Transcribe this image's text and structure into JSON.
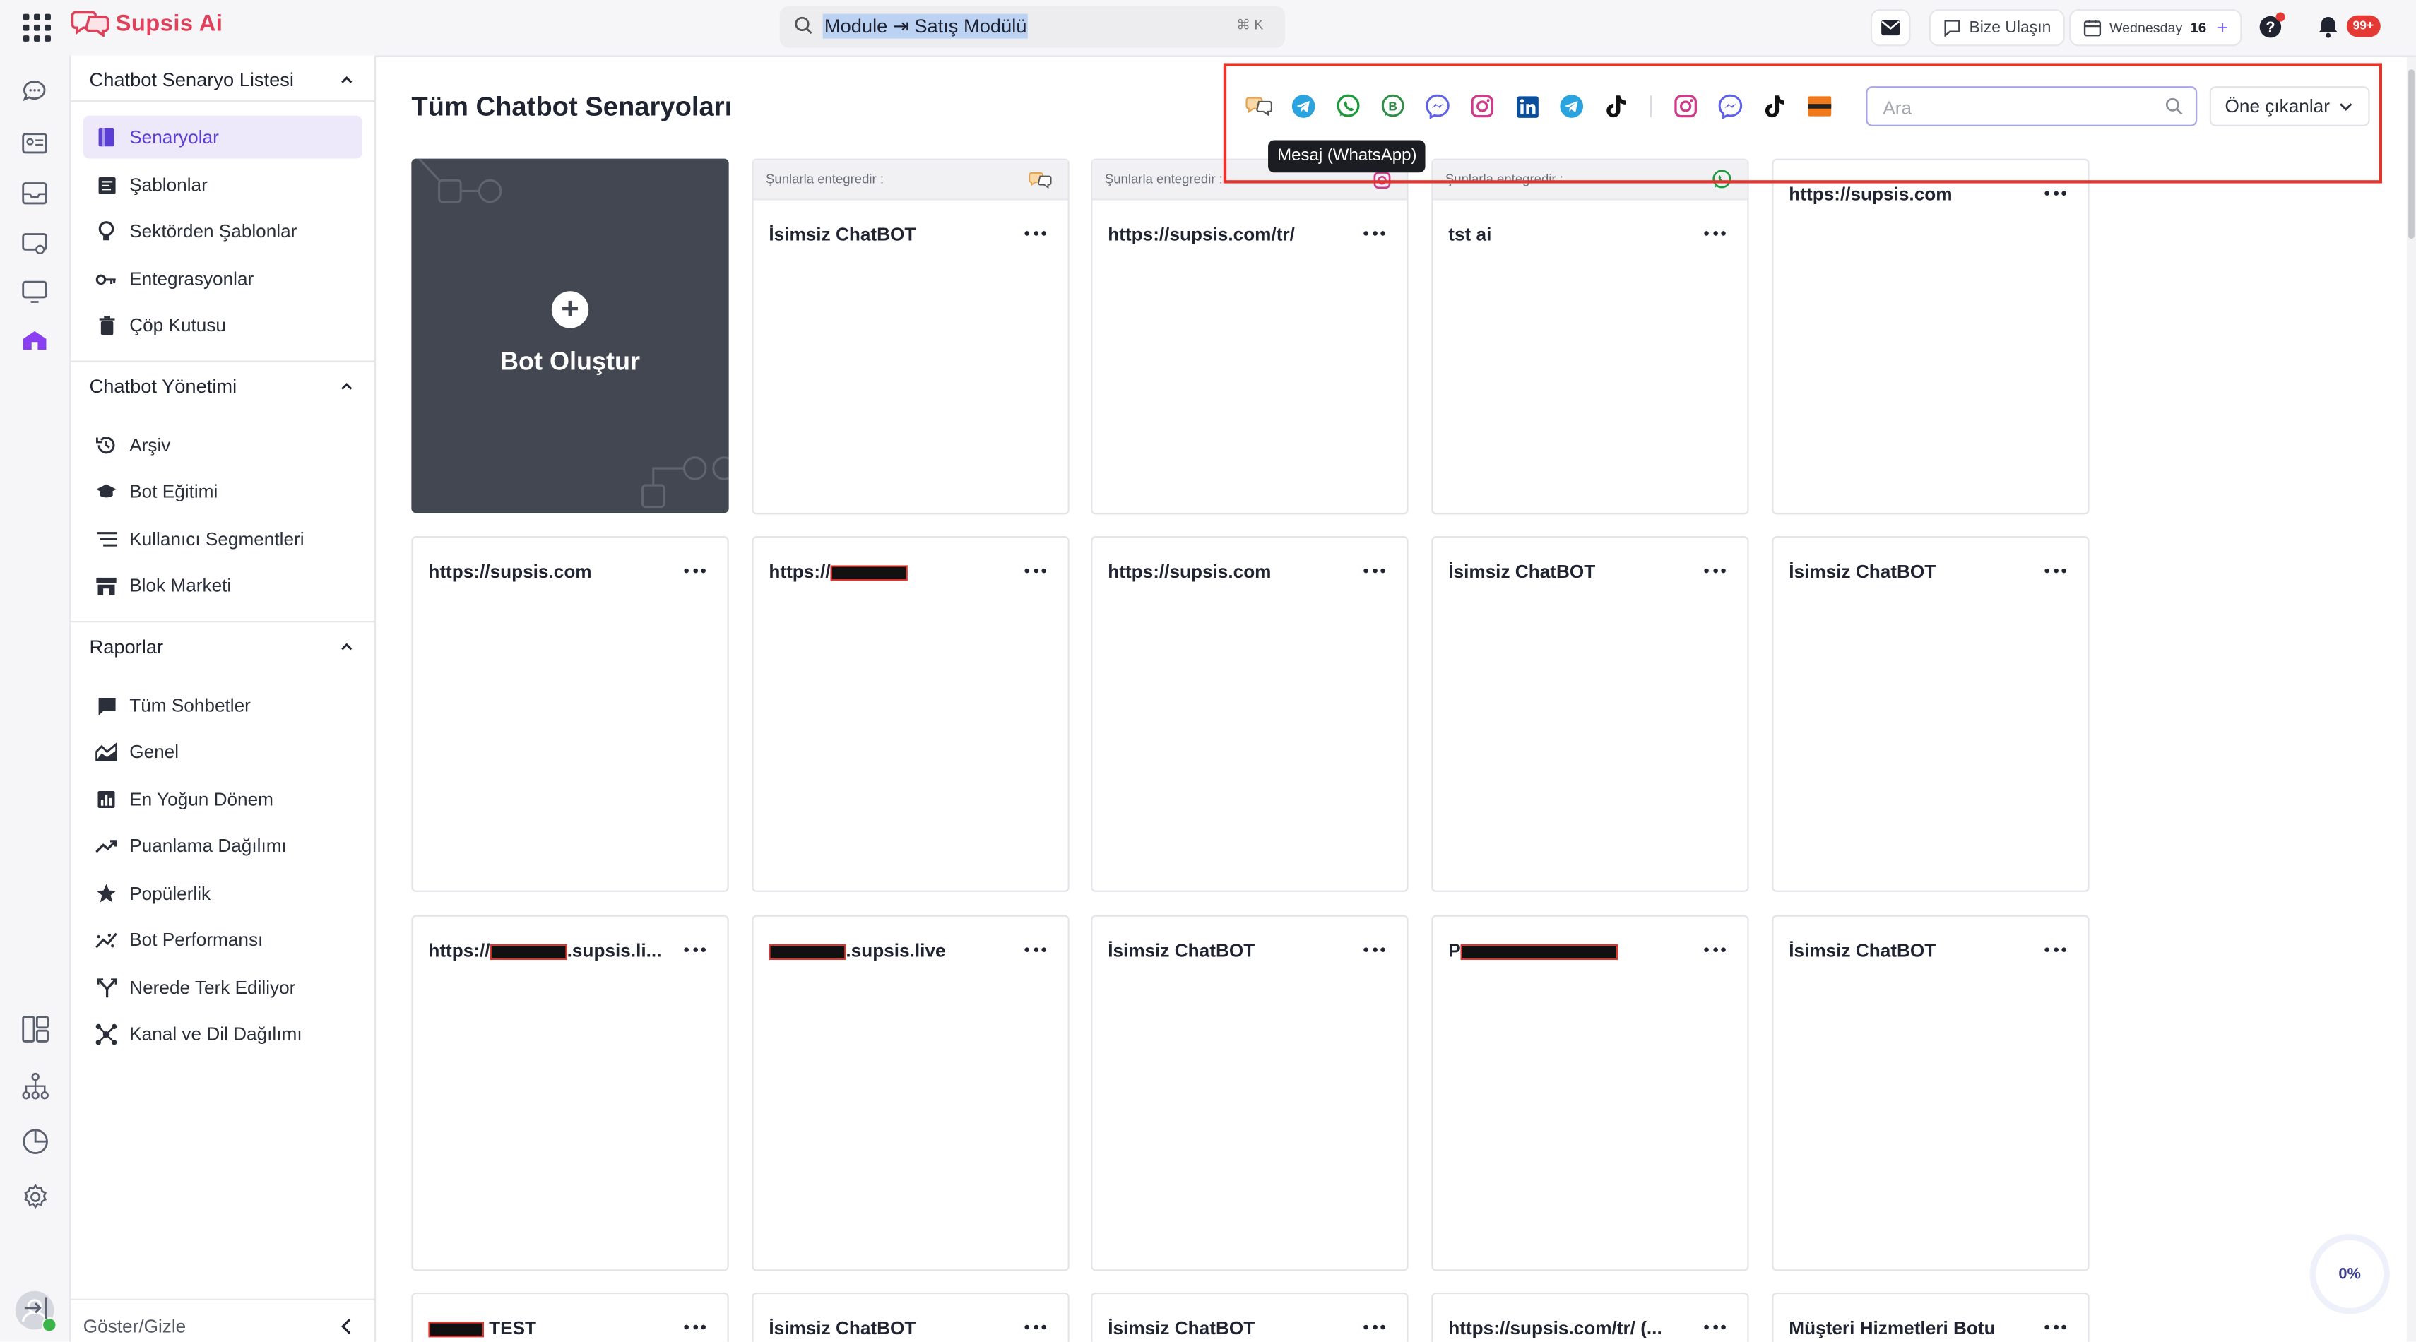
{
  "app": {
    "name": "Supsis Ai"
  },
  "topbar": {
    "search_text": "Module ⇥ Satış Modülü",
    "search_shortcut": "⌘ K",
    "contact_label": "Bize Ulaşın",
    "date_day": "Wednesday",
    "date_num": "16",
    "notification_count": "99+"
  },
  "sidebar": {
    "sections": [
      {
        "title": "Chatbot Senaryo Listesi",
        "items": [
          "Senaryolar",
          "Şablonlar",
          "Sektörden Şablonlar",
          "Entegrasyonlar",
          "Çöp Kutusu"
        ]
      },
      {
        "title": "Chatbot Yönetimi",
        "items": [
          "Arşiv",
          "Bot Eğitimi",
          "Kullanıcı Segmentleri",
          "Blok Marketi"
        ]
      },
      {
        "title": "Raporlar",
        "items": [
          "Tüm Sohbetler",
          "Genel",
          "En Yoğun Dönem",
          "Puanlama Dağılımı",
          "Popülerlik",
          "Bot Performansı",
          "Nerede Terk Ediliyor",
          "Kanal ve Dil Dağılımı"
        ]
      }
    ],
    "active_item": "Senaryolar",
    "toggle_label": "Göster/Gizle"
  },
  "main": {
    "title": "Tüm Chatbot Senaryoları",
    "search_placeholder": "Ara",
    "sort_label": "Öne çıkanlar",
    "tooltip": "Mesaj (WhatsApp)",
    "channels": [
      "livechat",
      "telegram",
      "whatsapp",
      "whatsapp-business",
      "messenger",
      "instagram",
      "linkedin",
      "telegram",
      "tiktok",
      "instagram",
      "messenger",
      "tiktok",
      "slide-bar"
    ],
    "create_label": "Bot Oluştur",
    "integrated_label": "Şunlarla entegredir :",
    "cards": [
      {
        "title": "İsimsiz ChatBOT",
        "integrated": true,
        "icon": "livechat"
      },
      {
        "title": "https://supsis.com/tr/",
        "integrated": true,
        "icon": "instagram"
      },
      {
        "title": "tst ai",
        "integrated": true,
        "icon": "whatsapp"
      },
      {
        "title": "https://supsis.com",
        "integrated": false
      },
      {
        "title": "https://supsis.com",
        "integrated": false
      },
      {
        "title": "https://",
        "integrated": false,
        "redacted_after": true
      },
      {
        "title": "https://supsis.com",
        "integrated": false
      },
      {
        "title": "İsimsiz ChatBOT",
        "integrated": false
      },
      {
        "title": "İsimsiz ChatBOT",
        "integrated": false
      },
      {
        "title": "https://",
        "integrated": false,
        "redacted_mid": true,
        "suffix": ".supsis.li..."
      },
      {
        "title": "",
        "integrated": false,
        "redacted_pre": true,
        "suffix": ".supsis.live"
      },
      {
        "title": "İsimsiz ChatBOT",
        "integrated": false
      },
      {
        "title": "P",
        "integrated": false,
        "redacted_after": true
      },
      {
        "title": "İsimsiz ChatBOT",
        "integrated": false
      },
      {
        "title": "",
        "integrated": false,
        "redacted_pre": true,
        "suffix": " TEST"
      },
      {
        "title": "İsimsiz ChatBOT",
        "integrated": false
      },
      {
        "title": "İsimsiz ChatBOT",
        "integrated": false
      },
      {
        "title": "https://supsis.com/tr/ (...",
        "integrated": false
      },
      {
        "title": "Müşteri Hizmetleri Botu",
        "integrated": false
      }
    ]
  },
  "progress": {
    "label": "0%"
  },
  "colors": {
    "accent": "#5b3fd4",
    "brand": "#e0415a",
    "highlight": "#e2352d"
  }
}
